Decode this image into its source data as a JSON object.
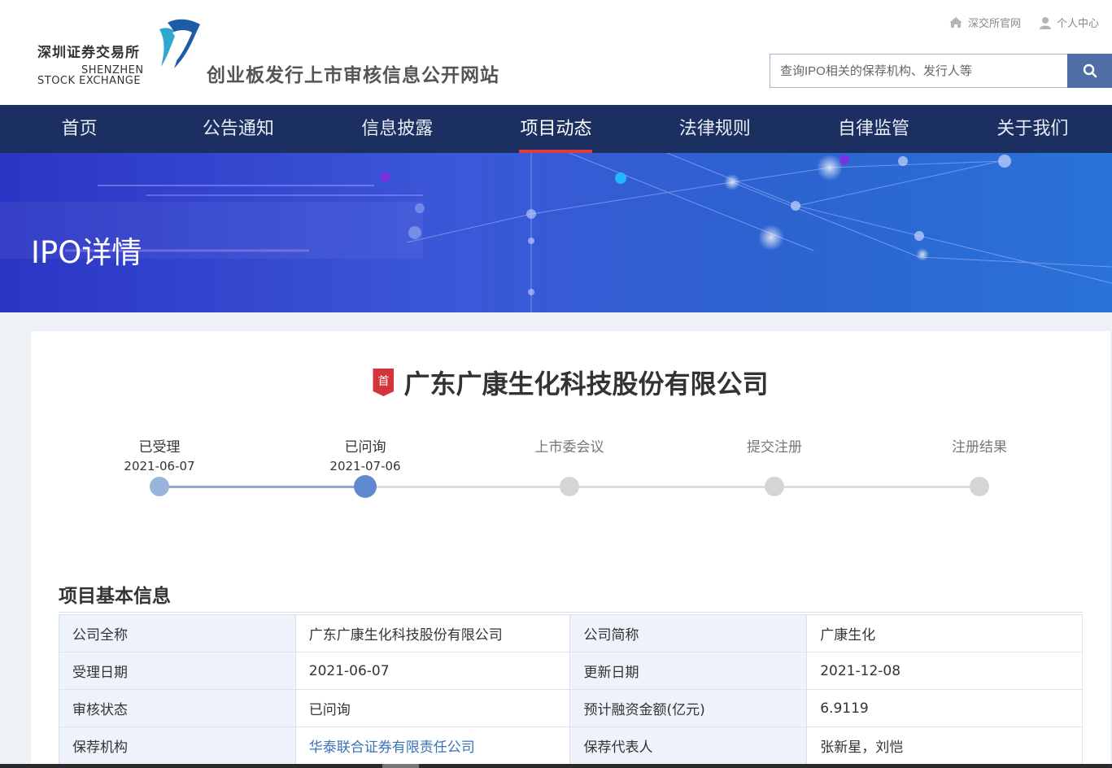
{
  "header": {
    "logo_cn": "深圳证券交易所",
    "logo_en_line1": "SHENZHEN",
    "logo_en_line2": "STOCK EXCHANGE",
    "site_title": "创业板发行上市审核信息公开网站",
    "links": [
      {
        "label": "深交所官网",
        "icon": "home-icon"
      },
      {
        "label": "个人中心",
        "icon": "user-icon"
      }
    ],
    "search_placeholder": "查询IPO相关的保荐机构、发行人等"
  },
  "nav": {
    "items": [
      "首页",
      "公告通知",
      "信息披露",
      "项目动态",
      "法律规则",
      "自律监管",
      "关于我们"
    ],
    "active": "项目动态"
  },
  "banner": {
    "title": "IPO详情"
  },
  "company": {
    "badge": "首",
    "name": "广东广康生化科技股份有限公司"
  },
  "progress": {
    "steps": [
      {
        "label": "已受理",
        "date": "2021-06-07",
        "state": "done"
      },
      {
        "label": "已问询",
        "date": "2021-07-06",
        "state": "current"
      },
      {
        "label": "上市委会议",
        "date": "",
        "state": "pending"
      },
      {
        "label": "提交注册",
        "date": "",
        "state": "pending"
      },
      {
        "label": "注册结果",
        "date": "",
        "state": "pending"
      }
    ],
    "colors": {
      "done": "#9ab3d9",
      "current": "#5f8ad0",
      "pending": "#d5d5d5"
    }
  },
  "basic_info": {
    "title": "项目基本信息",
    "rows": [
      [
        "公司全称",
        "广东广康生化科技股份有限公司",
        "公司简称",
        "广康生化"
      ],
      [
        "受理日期",
        "2021-06-07",
        "更新日期",
        "2021-12-08"
      ],
      [
        "审核状态",
        "已问询",
        "预计融资金额(亿元)",
        "6.9119"
      ],
      [
        "保荐机构",
        "华泰联合证券有限责任公司",
        "保荐代表人",
        "张新星，刘恺"
      ]
    ]
  }
}
